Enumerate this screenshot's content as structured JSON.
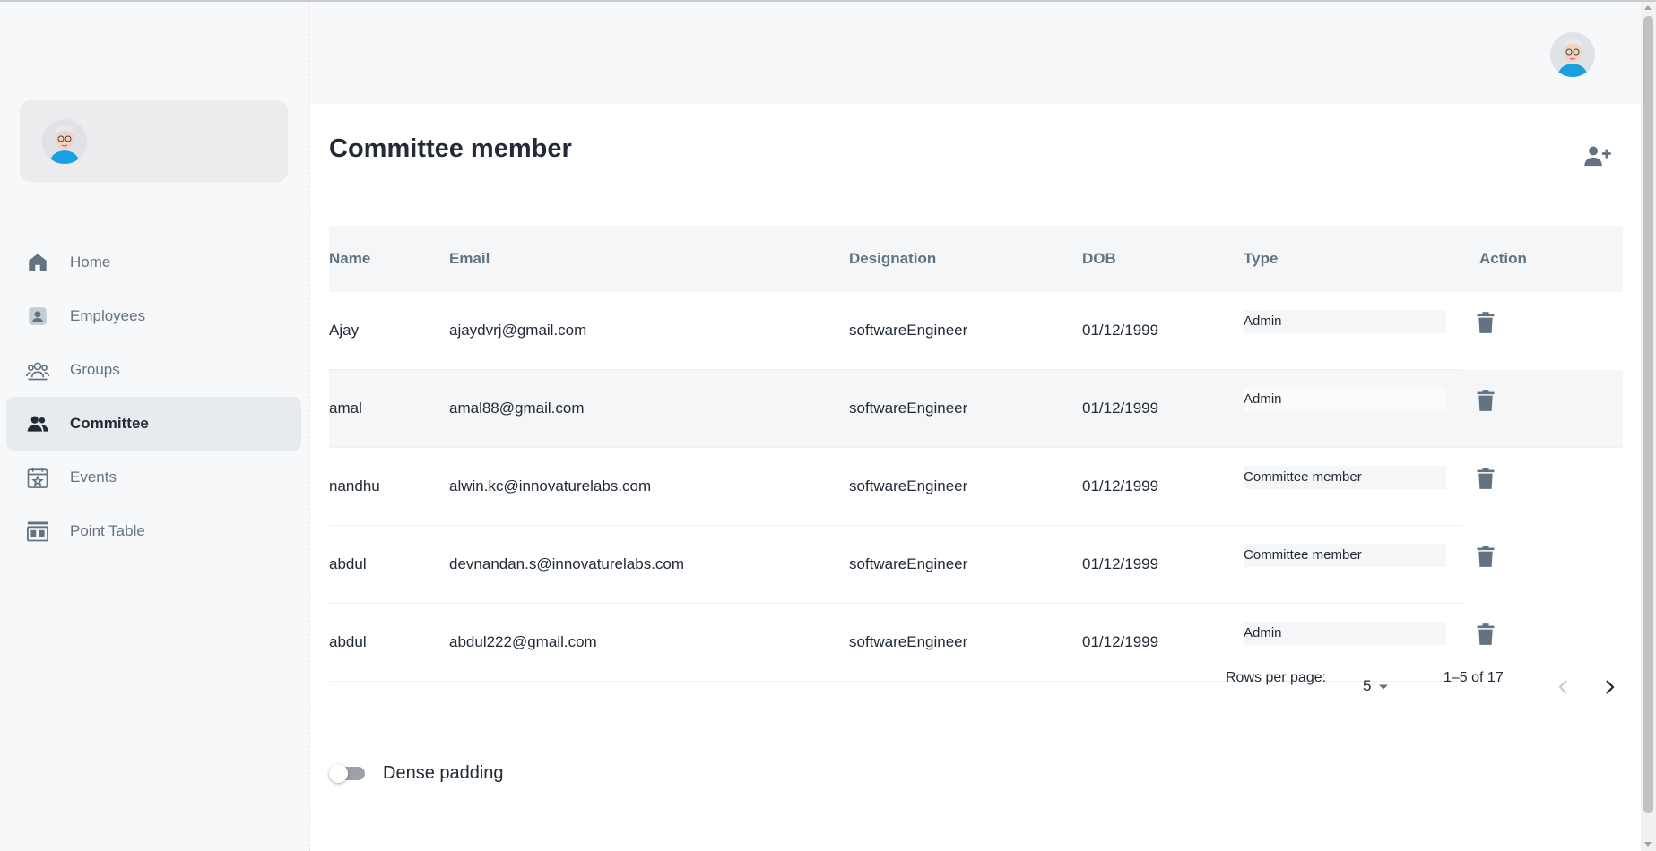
{
  "sidebar": {
    "items": [
      {
        "label": "Home",
        "icon": "home-icon"
      },
      {
        "label": "Employees",
        "icon": "employee-badge-icon"
      },
      {
        "label": "Groups",
        "icon": "groups-icon"
      },
      {
        "label": "Committee",
        "icon": "people-icon",
        "active": true
      },
      {
        "label": "Events",
        "icon": "calendar-star-icon"
      },
      {
        "label": "Point Table",
        "icon": "point-table-icon"
      }
    ]
  },
  "main": {
    "title": "Committee member",
    "add_icon": "person-add-icon",
    "table": {
      "headers": [
        "Name",
        "Email",
        "Designation",
        "DOB",
        "Type",
        "Action"
      ],
      "rows": [
        {
          "name": "Ajay",
          "email": "ajaydvrj@gmail.com",
          "designation": "softwareEngineer",
          "dob": "01/12/1999",
          "type": "Admin"
        },
        {
          "name": "amal",
          "email": "amal88@gmail.com",
          "designation": "softwareEngineer",
          "dob": "01/12/1999",
          "type": "Admin"
        },
        {
          "name": "nandhu",
          "email": "alwin.kc@innovaturelabs.com",
          "designation": "softwareEngineer",
          "dob": "01/12/1999",
          "type": "Committee member"
        },
        {
          "name": "abdul",
          "email": "devnandan.s@innovaturelabs.com",
          "designation": "softwareEngineer",
          "dob": "01/12/1999",
          "type": "Committee member"
        },
        {
          "name": "abdul",
          "email": "abdul222@gmail.com",
          "designation": "softwareEngineer",
          "dob": "01/12/1999",
          "type": "Admin"
        }
      ],
      "action_icon": "trash-icon"
    },
    "pagination": {
      "rows_per_page_label": "Rows per page:",
      "rows_per_page_value": "5",
      "range": "1–5 of 17"
    },
    "dense_padding": {
      "label": "Dense padding",
      "enabled": false
    }
  },
  "colors": {
    "sidebar_bg": "#f7f8fa",
    "active_bg": "#e8ebee",
    "text_primary": "#212b36",
    "text_secondary": "#637381",
    "table_header_bg": "#f4f6f8"
  }
}
